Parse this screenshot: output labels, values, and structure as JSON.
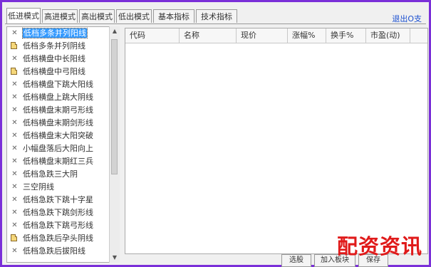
{
  "tabs": [
    {
      "label": "低进模式",
      "active": true
    },
    {
      "label": "高进模式",
      "active": false
    },
    {
      "label": "高出模式",
      "active": false
    },
    {
      "label": "低出模式",
      "active": false
    },
    {
      "label": "基本指标",
      "active": false
    },
    {
      "label": "技术指标",
      "active": false
    }
  ],
  "exit_label": "退出O支",
  "tree_items": [
    {
      "label": "低档多条并列阳线",
      "icon": "x",
      "selected": true
    },
    {
      "label": "低档多条并列阴线",
      "icon": "folder"
    },
    {
      "label": "低档横盘中长阳线",
      "icon": "x"
    },
    {
      "label": "低档横盘中弓阳线",
      "icon": "folder"
    },
    {
      "label": "低档横盘下跳大阳线",
      "icon": "x"
    },
    {
      "label": "低档横盘上跳大阴线",
      "icon": "x"
    },
    {
      "label": "低档横盘末期弓形线",
      "icon": "x"
    },
    {
      "label": "低档横盘末期剑形线",
      "icon": "x"
    },
    {
      "label": "低档横盘末大阳突破",
      "icon": "x"
    },
    {
      "label": "小幅盘落后大阳向上",
      "icon": "x"
    },
    {
      "label": "低档横盘末期红三兵",
      "icon": "x"
    },
    {
      "label": "低档急跌三大阴",
      "icon": "x"
    },
    {
      "label": "三空阴线",
      "icon": "x"
    },
    {
      "label": "低档急跌下跳十字星",
      "icon": "x"
    },
    {
      "label": "低档急跌下跳剑形线",
      "icon": "x"
    },
    {
      "label": "低档急跌下跳弓形线",
      "icon": "x"
    },
    {
      "label": "低档急跌后孕头阴线",
      "icon": "folder"
    },
    {
      "label": "低档急跌后拔阳线",
      "icon": "x"
    }
  ],
  "columns": [
    "代码",
    "名称",
    "现价",
    "涨幅%",
    "换手%",
    "市盈(动)"
  ],
  "buttons": [
    "选股",
    "加入板块",
    "保存"
  ],
  "watermark": "配资资讯",
  "colors": {
    "frame": "#7a2fd8",
    "selection": "#3399ff",
    "exit_link": "#1a4fd0",
    "watermark": "#e01a1a"
  }
}
